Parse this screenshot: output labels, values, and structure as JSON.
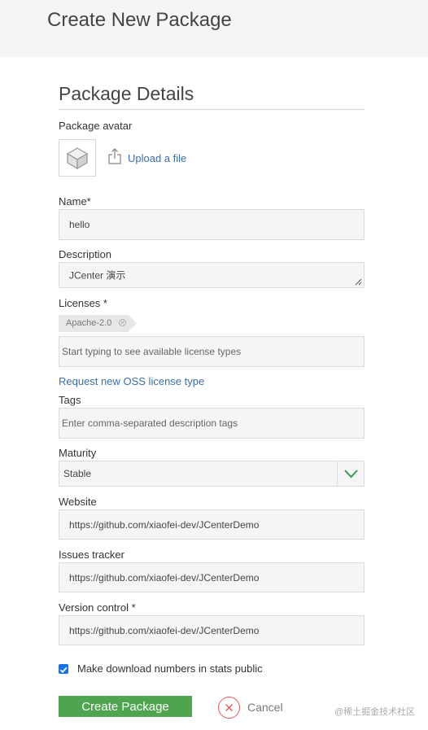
{
  "header": {
    "title": "Create New Package"
  },
  "section": {
    "title": "Package Details"
  },
  "avatar": {
    "label": "Package avatar",
    "upload_label": "Upload a file"
  },
  "name": {
    "label": "Name*",
    "value": "hello"
  },
  "description": {
    "label": "Description",
    "value": "JCenter 演示"
  },
  "licenses": {
    "label": "Licenses *",
    "selected": [
      "Apache-2.0"
    ],
    "placeholder": "Start typing to see available license types",
    "request_link": "Request new OSS license type"
  },
  "tags": {
    "label": "Tags",
    "placeholder": "Enter comma-separated description tags"
  },
  "maturity": {
    "label": "Maturity",
    "value": "Stable"
  },
  "website": {
    "label": "Website",
    "value": "https://github.com/xiaofei-dev/JCenterDemo"
  },
  "issues_tracker": {
    "label": "Issues tracker",
    "value": "https://github.com/xiaofei-dev/JCenterDemo"
  },
  "version_control": {
    "label": "Version control *",
    "value": "https://github.com/xiaofei-dev/JCenterDemo"
  },
  "stats_public": {
    "label": "Make download numbers in stats public",
    "checked": true
  },
  "actions": {
    "create_label": "Create Package",
    "cancel_label": "Cancel"
  },
  "watermark": "@稀土掘金技术社区",
  "colors": {
    "accent_link": "#3b6ea5",
    "primary_button": "#4fa54f",
    "cancel_icon": "#e05a5a",
    "checkbox": "#1a73e8"
  }
}
